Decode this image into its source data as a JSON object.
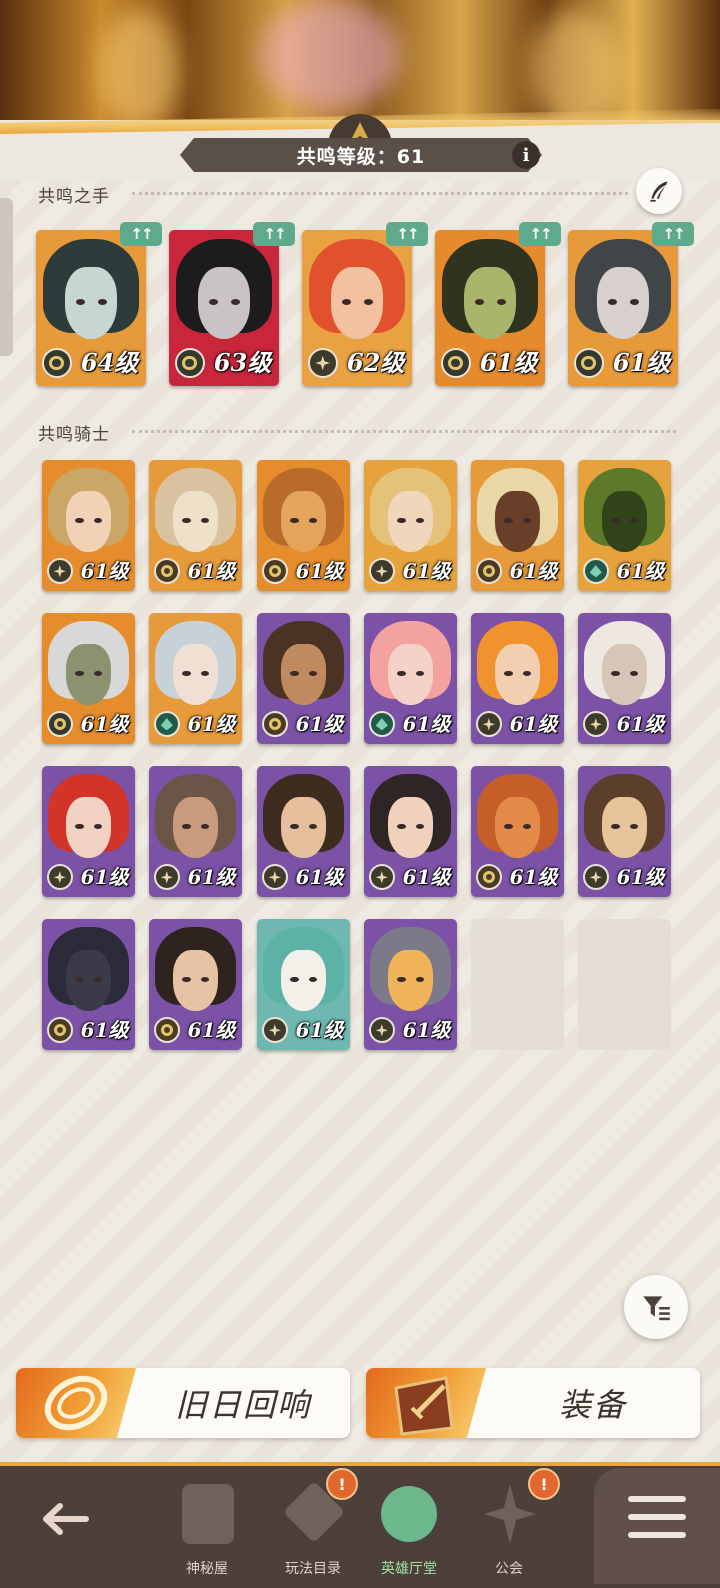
{
  "header": {
    "resonance_label": "共鸣等级：61",
    "info_label": "i"
  },
  "sections": {
    "hands_title": "共鸣之手",
    "knights_title": "共鸣骑士"
  },
  "hands": [
    {
      "level": "64级",
      "hair": "#2d3b3a",
      "skin": "#c8d6d2",
      "bg": "#e69a3a",
      "cls": "graveborn"
    },
    {
      "level": "63级",
      "hair": "#1c1c1c",
      "skin": "#c9c2c7",
      "bg": "#c8263a",
      "cls": "graveborn"
    },
    {
      "level": "62级",
      "hair": "#e2512d",
      "skin": "#f2c2a0",
      "bg": "#e8a242",
      "cls": "lightbearer"
    },
    {
      "level": "61级",
      "hair": "#2f3320",
      "skin": "#a8b56a",
      "bg": "#e58a2d",
      "cls": "graveborn"
    },
    {
      "level": "61级",
      "hair": "#404548",
      "skin": "#d8cfcf",
      "bg": "#e69a3a",
      "cls": "graveborn"
    }
  ],
  "knights": [
    {
      "level": "61级",
      "hair": "#c9a766",
      "skin": "#f1d2b6",
      "bg": "#e58d2d",
      "cls": "lightbearer"
    },
    {
      "level": "61级",
      "hair": "#d9c2a0",
      "skin": "#efe0c9",
      "bg": "#e69a3a",
      "cls": "mauler"
    },
    {
      "level": "61级",
      "hair": "#b86b2a",
      "skin": "#e4a45b",
      "bg": "#e58d2d",
      "cls": "mauler"
    },
    {
      "level": "61级",
      "hair": "#e3c27a",
      "skin": "#f2d6bb",
      "bg": "#e6a23c",
      "cls": "lightbearer"
    },
    {
      "level": "61级",
      "hair": "#e9d7a8",
      "skin": "#6a3f2a",
      "bg": "#e69a3a",
      "cls": "mauler"
    },
    {
      "level": "61级",
      "hair": "#5d7a2a",
      "skin": "#314318",
      "bg": "#e6a23c",
      "cls": "wilder"
    },
    {
      "level": "61级",
      "hair": "#d8d8d8",
      "skin": "#8c9270",
      "bg": "#e58d2d",
      "cls": "graveborn"
    },
    {
      "level": "61级",
      "hair": "#c7d2d8",
      "skin": "#f0dfd3",
      "bg": "#e69a3a",
      "cls": "wilder"
    },
    {
      "level": "61级",
      "hair": "#4a3322",
      "skin": "#c08a5e",
      "bg": "#7c52a6",
      "cls": "mauler"
    },
    {
      "level": "61级",
      "hair": "#f3a2a0",
      "skin": "#f5d2c7",
      "bg": "#7c52a6",
      "cls": "wilder"
    },
    {
      "level": "61级",
      "hair": "#f0922d",
      "skin": "#f3cfb2",
      "bg": "#7c52a6",
      "cls": "lightbearer"
    },
    {
      "level": "61级",
      "hair": "#efe8e0",
      "skin": "#d6c5b8",
      "bg": "#7c52a6",
      "cls": "lightbearer"
    },
    {
      "level": "61级",
      "hair": "#d23528",
      "skin": "#f1d2c2",
      "bg": "#7c52a6",
      "cls": "lightbearer"
    },
    {
      "level": "61级",
      "hair": "#6a5546",
      "skin": "#c99b7c",
      "bg": "#7c52a6",
      "cls": "lightbearer"
    },
    {
      "level": "61级",
      "hair": "#3e2c1f",
      "skin": "#e6bf9c",
      "bg": "#7c52a6",
      "cls": "lightbearer"
    },
    {
      "level": "61级",
      "hair": "#2e2524",
      "skin": "#f0d1bb",
      "bg": "#7c52a6",
      "cls": "lightbearer"
    },
    {
      "level": "61级",
      "hair": "#c65e2a",
      "skin": "#e48a48",
      "bg": "#7c52a6",
      "cls": "mauler"
    },
    {
      "level": "61级",
      "hair": "#5b3f2b",
      "skin": "#e6c49a",
      "bg": "#7c52a6",
      "cls": "lightbearer"
    },
    {
      "level": "61级",
      "hair": "#2b2b3a",
      "skin": "#3a3a48",
      "bg": "#7c52a6",
      "cls": "mauler"
    },
    {
      "level": "61级",
      "hair": "#2e231e",
      "skin": "#e7c3a6",
      "bg": "#7c52a6",
      "cls": "mauler"
    },
    {
      "level": "61级",
      "hair": "#5cb2a4",
      "skin": "#f3efe9",
      "bg": "#6fb8b2",
      "cls": "lightbearer"
    },
    {
      "level": "61级",
      "hair": "#7c7a88",
      "skin": "#f0b35a",
      "bg": "#7c52a6",
      "cls": "lightbearer"
    }
  ],
  "buttons": {
    "echoes_label": "旧日回响",
    "equipment_label": "装备"
  },
  "nav": {
    "mystery_label": "神秘屋",
    "modes_label": "玩法目录",
    "heroes_label": "英雄厅堂",
    "guild_label": "公会",
    "badge_modes": "!",
    "badge_guild": "!"
  },
  "colors": {
    "accent": "#e7a543",
    "nav_bg": "#4d403a",
    "active_nav": "#9fe0a6",
    "upgrade_badge": "#5fa98c"
  }
}
